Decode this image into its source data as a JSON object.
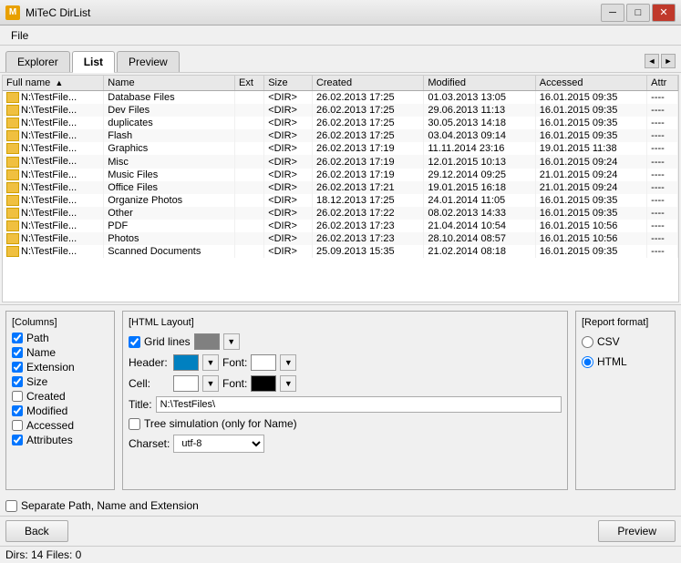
{
  "window": {
    "title": "MiTeC DirList",
    "icon": "M"
  },
  "menu": {
    "items": [
      "File"
    ]
  },
  "tabs": {
    "items": [
      "Explorer",
      "List",
      "Preview"
    ],
    "active": "List"
  },
  "table": {
    "columns": [
      "Full name",
      "Name",
      "Ext",
      "Size",
      "Created",
      "Modified",
      "Accessed",
      "Attr"
    ],
    "sort_col": "Full name",
    "sort_dir": "asc",
    "rows": [
      [
        "N:\\TestFile...",
        "Database Files",
        "",
        "<DIR>",
        "26.02.2013 17:25",
        "01.03.2013 13:05",
        "16.01.2015 09:35",
        "----"
      ],
      [
        "N:\\TestFile...",
        "Dev Files",
        "",
        "<DIR>",
        "26.02.2013 17:25",
        "29.06.2013 11:13",
        "16.01.2015 09:35",
        "----"
      ],
      [
        "N:\\TestFile...",
        "duplicates",
        "",
        "<DIR>",
        "26.02.2013 17:25",
        "30.05.2013 14:18",
        "16.01.2015 09:35",
        "----"
      ],
      [
        "N:\\TestFile...",
        "Flash",
        "",
        "<DIR>",
        "26.02.2013 17:25",
        "03.04.2013 09:14",
        "16.01.2015 09:35",
        "----"
      ],
      [
        "N:\\TestFile...",
        "Graphics",
        "",
        "<DIR>",
        "26.02.2013 17:19",
        "11.11.2014 23:16",
        "19.01.2015 11:38",
        "----"
      ],
      [
        "N:\\TestFile...",
        "Misc",
        "",
        "<DIR>",
        "26.02.2013 17:19",
        "12.01.2015 10:13",
        "16.01.2015 09:24",
        "----"
      ],
      [
        "N:\\TestFile...",
        "Music Files",
        "",
        "<DIR>",
        "26.02.2013 17:19",
        "29.12.2014 09:25",
        "21.01.2015 09:24",
        "----"
      ],
      [
        "N:\\TestFile...",
        "Office Files",
        "",
        "<DIR>",
        "26.02.2013 17:21",
        "19.01.2015 16:18",
        "21.01.2015 09:24",
        "----"
      ],
      [
        "N:\\TestFile...",
        "Organize Photos",
        "",
        "<DIR>",
        "18.12.2013 17:25",
        "24.01.2014 11:05",
        "16.01.2015 09:35",
        "----"
      ],
      [
        "N:\\TestFile...",
        "Other",
        "",
        "<DIR>",
        "26.02.2013 17:22",
        "08.02.2013 14:33",
        "16.01.2015 09:35",
        "----"
      ],
      [
        "N:\\TestFile...",
        "PDF",
        "",
        "<DIR>",
        "26.02.2013 17:23",
        "21.04.2014 10:54",
        "16.01.2015 10:56",
        "----"
      ],
      [
        "N:\\TestFile...",
        "Photos",
        "",
        "<DIR>",
        "26.02.2013 17:23",
        "28.10.2014 08:57",
        "16.01.2015 10:56",
        "----"
      ],
      [
        "N:\\TestFile...",
        "Scanned Documents",
        "",
        "<DIR>",
        "25.09.2013 15:35",
        "21.02.2014 08:18",
        "16.01.2015 09:35",
        "----"
      ]
    ]
  },
  "columns_panel": {
    "title": "[Columns]",
    "items": [
      {
        "label": "Path",
        "checked": true
      },
      {
        "label": "Name",
        "checked": true
      },
      {
        "label": "Extension",
        "checked": true
      },
      {
        "label": "Size",
        "checked": true
      },
      {
        "label": "Created",
        "checked": false
      },
      {
        "label": "Modified",
        "checked": true
      },
      {
        "label": "Accessed",
        "checked": false
      },
      {
        "label": "Attributes",
        "checked": true
      }
    ]
  },
  "html_layout": {
    "title": "[HTML Layout]",
    "grid_lines": {
      "checked": true,
      "color": "#808080"
    },
    "header": {
      "color": "#0080C0",
      "font_color": "#FFFFFF"
    },
    "cell": {
      "color": "#FFFFFF",
      "font_color": "#000000"
    },
    "title_value": "N:\\TestFiles\\",
    "tree_simulation": {
      "checked": false,
      "label": "Tree simulation (only for Name)"
    },
    "charset_label": "Charset:",
    "charset_value": "utf-8"
  },
  "report_format": {
    "title": "[Report format]",
    "options": [
      "CSV",
      "HTML"
    ],
    "selected": "HTML"
  },
  "separate_path": {
    "checked": false,
    "label": "Separate Path, Name and Extension"
  },
  "buttons": {
    "back": "Back",
    "preview": "Preview"
  },
  "status_bar": {
    "text": "Dirs: 14  Files: 0"
  }
}
